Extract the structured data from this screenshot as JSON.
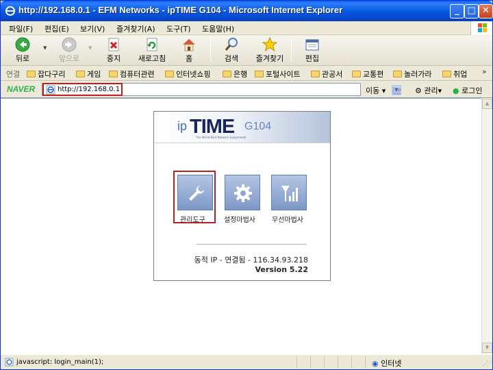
{
  "window": {
    "title": "http://192.168.0.1 - EFM Networks - ipTIME G104 - Microsoft Internet Explorer",
    "controls": {
      "minimize": "_",
      "maximize": "□",
      "close": "✕"
    }
  },
  "menubar": [
    "파일(F)",
    "편집(E)",
    "보기(V)",
    "즐겨찾기(A)",
    "도구(T)",
    "도움말(H)"
  ],
  "toolbar": {
    "back": "뒤로",
    "forward": "앞으로",
    "stop": "중지",
    "refresh": "새로고침",
    "home": "홈",
    "search": "검색",
    "favorites": "즐겨찾기",
    "edit": "편집"
  },
  "links": {
    "label": "연결",
    "items": [
      "잡다구리",
      "게임",
      "컴퓨터관련",
      "인터넷쇼핑",
      "은행",
      "포털사이트",
      "관공서",
      "교통편",
      "놀러가라",
      "취업"
    ],
    "overflow": "»"
  },
  "addressbar": {
    "brand": "NAVER",
    "url": "http://192.168.0.1",
    "go": "이동",
    "manage": "관리",
    "login": "로그인"
  },
  "router": {
    "logo_ip": "ip",
    "logo_time": "TIME",
    "logo_model": "G104",
    "tagline": "The World Best Network Equipments",
    "menu": [
      "관리도구",
      "설정마법사",
      "무선마법사"
    ],
    "status": "동적 IP - 연결됨 - 116.34.93.218",
    "version": "Version 5.22"
  },
  "statusbar": {
    "text": "javascript: login_main(1);",
    "zone": "인터넷"
  },
  "icons": {
    "ie": "ie-icon",
    "back": "back-arrow-icon",
    "forward": "forward-arrow-icon",
    "stop": "stop-icon",
    "refresh": "refresh-icon",
    "home": "home-icon",
    "search": "search-icon",
    "favorites": "star-icon",
    "edit": "edit-icon",
    "tool": "wrench-icon",
    "setup": "gear-icon",
    "wireless": "antenna-signal-icon"
  }
}
